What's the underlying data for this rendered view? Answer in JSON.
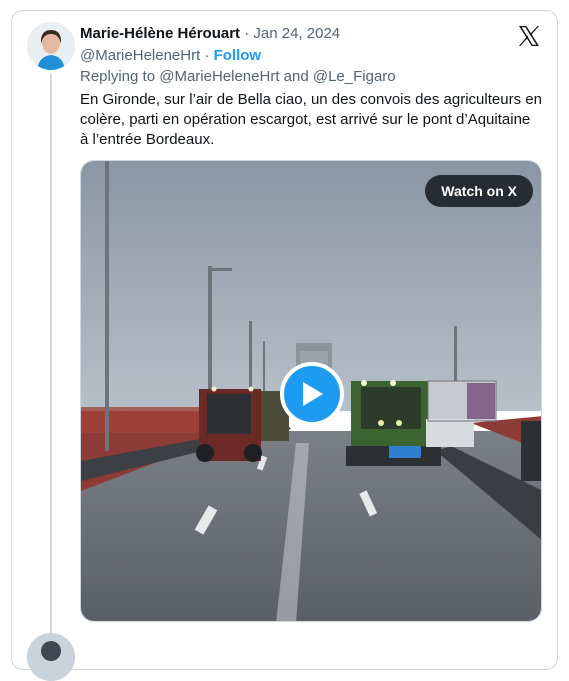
{
  "tweet": {
    "author_name": "Marie-Hélène Hérouart",
    "separator": " · ",
    "date": "Jan 24, 2024",
    "handle": "@MarieHeleneHrt",
    "handle_separator": " · ",
    "follow_label": "Follow",
    "reply_prefix": "Replying to ",
    "reply_user_1": "@MarieHeleneHrt",
    "reply_and": " and ",
    "reply_user_2": "@Le_Figaro",
    "text": "En Gironde, sur l’air de Bella ciao, un des convois des agriculteurs en colère, parti en opération escargot, est arrivé sur le pont d’Aquitaine à l’entrée Bordeaux."
  },
  "media": {
    "type": "video",
    "watch_label": "Watch on X",
    "play_icon": "play-icon"
  },
  "icons": {
    "platform_logo": "x-logo-icon",
    "avatar": "avatar"
  },
  "colors": {
    "accent": "#1d9bf0",
    "text": "#0f1419",
    "muted": "#536471",
    "border": "#cfd9de"
  }
}
